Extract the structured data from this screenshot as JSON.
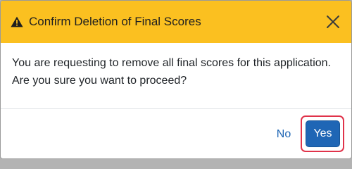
{
  "dialog": {
    "title": "Confirm Deletion of Final Scores",
    "title_icon": "warning-triangle-icon",
    "close_icon": "close-icon",
    "message_lines": [
      "You are requesting to remove all final scores for this application.",
      "Are you sure you want to proceed?"
    ],
    "buttons": {
      "no_label": "No",
      "yes_label": "Yes"
    },
    "colors": {
      "header_bg": "#fbc020",
      "primary": "#1f66b5",
      "highlight": "#e0334a"
    }
  }
}
